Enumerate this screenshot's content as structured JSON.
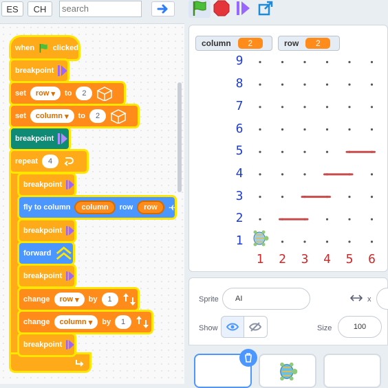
{
  "toolbar": {
    "lang1": "ES",
    "lang2": "CH",
    "search_placeholder": "search"
  },
  "code": {
    "when_flag": {
      "when": "when",
      "clicked": "clicked"
    },
    "breakpoint": "breakpoint",
    "set_row": {
      "set": "set",
      "var": "row",
      "to": "to",
      "value": "2"
    },
    "set_column": {
      "set": "set",
      "var": "column",
      "to": "to",
      "value": "2"
    },
    "repeat": {
      "label": "repeat",
      "value": "4"
    },
    "fly": {
      "label": "fly to column",
      "arg1": "column",
      "mid": "row",
      "arg2": "row"
    },
    "forward": "forward",
    "change_row": {
      "label": "change",
      "var": "row",
      "by": "by",
      "value": "1"
    },
    "change_column": {
      "label": "change",
      "var": "column",
      "by": "by",
      "value": "1"
    }
  },
  "stage": {
    "monitor_column": {
      "label": "column",
      "value": "2"
    },
    "monitor_row": {
      "label": "row",
      "value": "2"
    },
    "y_labels": [
      "9",
      "8",
      "7",
      "6",
      "5",
      "4",
      "3",
      "2",
      "1"
    ],
    "x_labels": [
      "1",
      "2",
      "3",
      "4",
      "5",
      "6"
    ],
    "path_color": "#c94a4a",
    "y_color": "#1f3dcc",
    "x_color": "#d12626"
  },
  "sprite_info": {
    "sprite_label": "Sprite",
    "sprite_name": "AI",
    "x_label": "x",
    "show_label": "Show",
    "size_label": "Size",
    "size_value": "100"
  }
}
